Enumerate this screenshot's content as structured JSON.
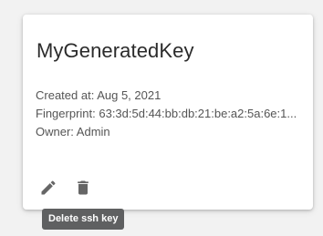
{
  "key_card": {
    "title": "MyGeneratedKey",
    "created_at": "Created at: Aug 5, 2021",
    "fingerprint": "Fingerprint: 63:3d:5d:44:bb:db:21:be:a2:5a:6e:1...",
    "owner": "Owner: Admin",
    "actions": {
      "edit_icon": "pencil-icon",
      "delete_icon": "trash-icon"
    }
  },
  "tooltip": {
    "text": "Delete ssh key"
  },
  "colors": {
    "icon": "#666666",
    "tooltip_background": "#5f6061",
    "text": "#555555",
    "title": "#2b2b2b"
  }
}
